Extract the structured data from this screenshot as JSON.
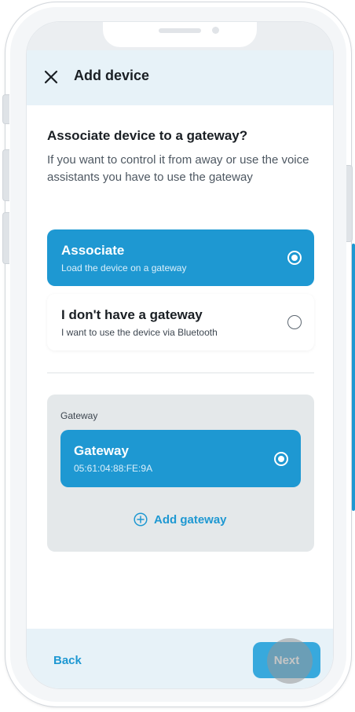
{
  "header": {
    "title": "Add device",
    "close_icon": "close-icon"
  },
  "question": {
    "title": "Associate device to a gateway?",
    "description": "If you want to control it from away or use the voice assistants you have to use the gateway"
  },
  "options": [
    {
      "title": "Associate",
      "subtitle": "Load the device on a gateway",
      "selected": true
    },
    {
      "title": "I don't have a gateway",
      "subtitle": "I want to use the device via Bluetooth",
      "selected": false
    }
  ],
  "gateway_section": {
    "label": "Gateway",
    "items": [
      {
        "name": "Gateway",
        "mac": "05:61:04:88:FE:9A",
        "selected": true
      }
    ],
    "add_label": "Add gateway",
    "add_icon": "plus-circle-icon"
  },
  "footer": {
    "back_label": "Back",
    "next_label": "Next"
  },
  "colors": {
    "accent": "#1e98d2",
    "header_bg": "#e7f2f8",
    "panel_bg": "#e4e8ea"
  }
}
